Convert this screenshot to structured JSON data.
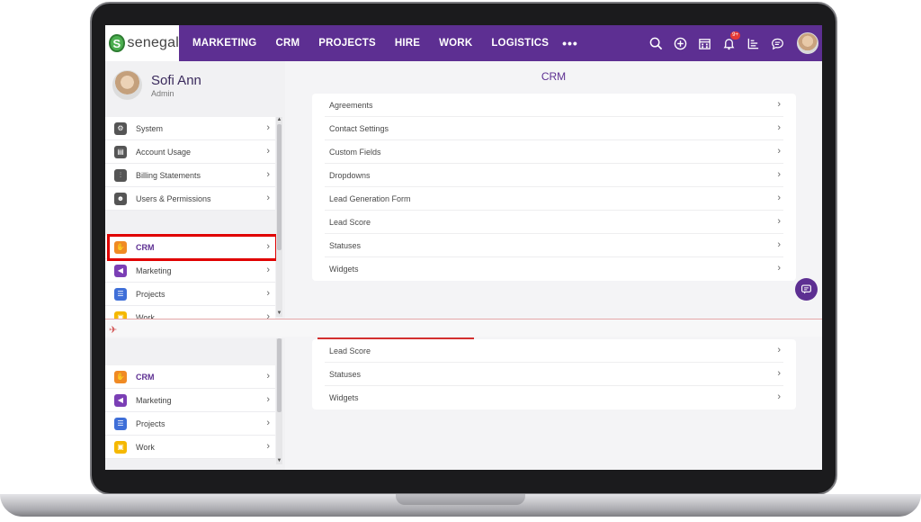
{
  "topnav": {
    "logo_text": "senegal",
    "logo_mark": "S",
    "items": [
      "MARKETING",
      "CRM",
      "PROJECTS",
      "HIRE",
      "WORK",
      "LOGISTICS"
    ],
    "more": "•••",
    "notification_badge": "9+",
    "icons": [
      "search-icon",
      "add-circle-icon",
      "calendar-icon",
      "bell-icon",
      "chart-icon",
      "chat-icon"
    ]
  },
  "profile": {
    "name": "Sofi Ann",
    "role": "Admin"
  },
  "sidebar": {
    "system_items": [
      {
        "label": "System",
        "icon": "gear-icon",
        "color": "#555555"
      },
      {
        "label": "Account Usage",
        "icon": "chart-icon",
        "color": "#555555"
      },
      {
        "label": "Billing Statements",
        "icon": "sliders-icon",
        "color": "#555555"
      },
      {
        "label": "Users & Permissions",
        "icon": "users-icon",
        "color": "#555555"
      }
    ],
    "app_items": [
      {
        "label": "CRM",
        "icon": "handshake-icon",
        "color": "#f08a24"
      },
      {
        "label": "Marketing",
        "icon": "megaphone-icon",
        "color": "#7b3fb5"
      },
      {
        "label": "Projects",
        "icon": "list-icon",
        "color": "#3f6fd8"
      },
      {
        "label": "Work",
        "icon": "briefcase-icon",
        "color": "#f5b800"
      }
    ]
  },
  "main": {
    "title": "CRM",
    "rows": [
      "Agreements",
      "Contact Settings",
      "Custom Fields",
      "Dropdowns",
      "Lead Generation Form",
      "Lead Score",
      "Statuses",
      "Widgets"
    ],
    "rows_repeat": [
      "Lead Score",
      "Statuses",
      "Widgets"
    ]
  },
  "colors": {
    "brand": "#5d2f92",
    "highlight": "#e00000"
  }
}
